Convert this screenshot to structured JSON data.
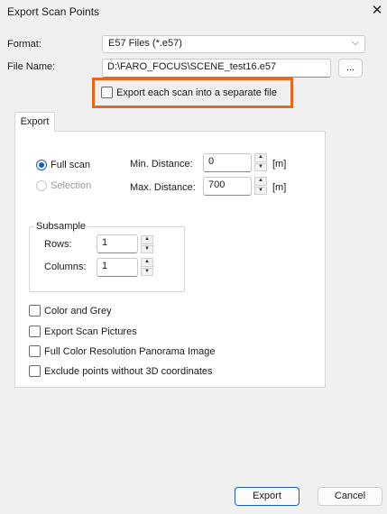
{
  "window": {
    "title": "Export Scan Points",
    "close_glyph": "✕"
  },
  "form": {
    "format_label": "Format:",
    "format_value": "E57 Files (*.e57)",
    "filename_label": "File Name:",
    "filename_value": "D:\\FARO_FOCUS\\SCENE_test16.e57",
    "browse_label": "...",
    "separate_file_label": "Export each scan into a separate file",
    "separate_file_checked": false
  },
  "tab": {
    "label": "Export"
  },
  "export": {
    "full_scan_label": "Full scan",
    "selection_label": "Selection",
    "min_distance_label": "Min. Distance:",
    "min_distance_value": "0",
    "max_distance_label": "Max. Distance:",
    "max_distance_value": "700",
    "unit_label": "[m]",
    "subsample_label": "Subsample",
    "rows_label": "Rows:",
    "rows_value": "1",
    "columns_label": "Columns:",
    "columns_value": "1",
    "options": [
      {
        "label": "Color and Grey",
        "checked": false
      },
      {
        "label": "Export Scan Pictures",
        "checked": false
      },
      {
        "label": "Full Color Resolution Panorama Image",
        "checked": false
      },
      {
        "label": "Exclude points without 3D coordinates",
        "checked": false
      }
    ]
  },
  "footer": {
    "export_label": "Export",
    "cancel_label": "Cancel"
  },
  "colors": {
    "highlight": "#e8661d",
    "accent": "#1c5fb8"
  }
}
